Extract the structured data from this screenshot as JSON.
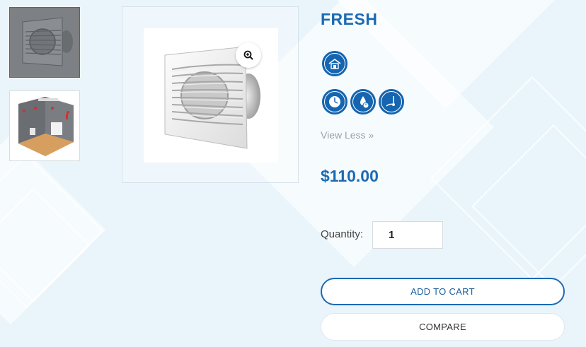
{
  "product": {
    "title": "FRESH",
    "view_toggle_label": "View Less",
    "price": "$110.00"
  },
  "gallery": {
    "thumbnails": [
      {
        "name": "fan-front-view",
        "selected": true
      },
      {
        "name": "bathroom-installation-view",
        "selected": false
      }
    ],
    "zoom_icon": "magnify-plus-icon"
  },
  "feature_icons": {
    "row1": [
      "house-icon"
    ],
    "row2": [
      "timer-icon",
      "humidity-timer-icon",
      "pull-cord-icon"
    ]
  },
  "quantity": {
    "label": "Quantity:",
    "value": "1"
  },
  "actions": {
    "add_to_cart": "ADD TO CART",
    "compare": "COMPARE"
  },
  "colors": {
    "brand_blue": "#1b6ab4",
    "background": "#eaf5fb"
  }
}
